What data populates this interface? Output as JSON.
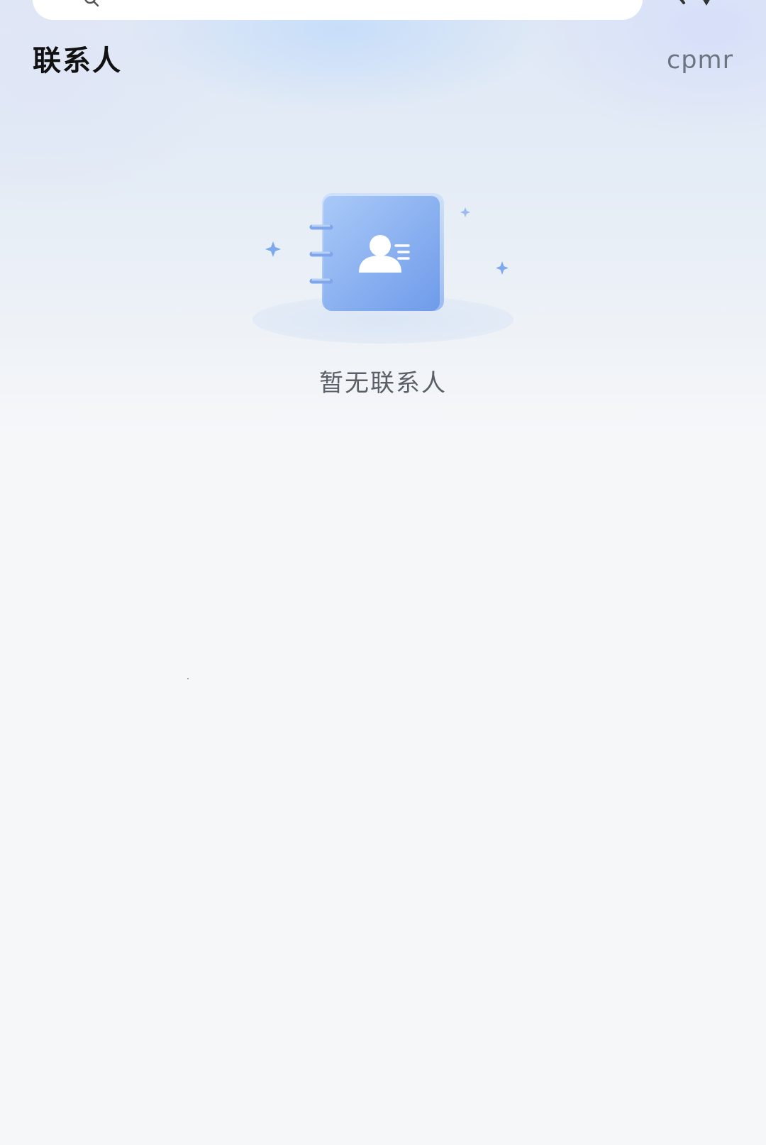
{
  "header": {
    "title": "联系人",
    "action_label": "cpmr"
  },
  "search": {
    "placeholder": ""
  },
  "empty_state": {
    "message": "暂无联系人",
    "illustration_icon": "contact-book-icon"
  },
  "colors": {
    "accent": "#7fa9ee",
    "title": "#111111",
    "secondary_text": "#6b7480",
    "background": "#f6f7f9"
  }
}
